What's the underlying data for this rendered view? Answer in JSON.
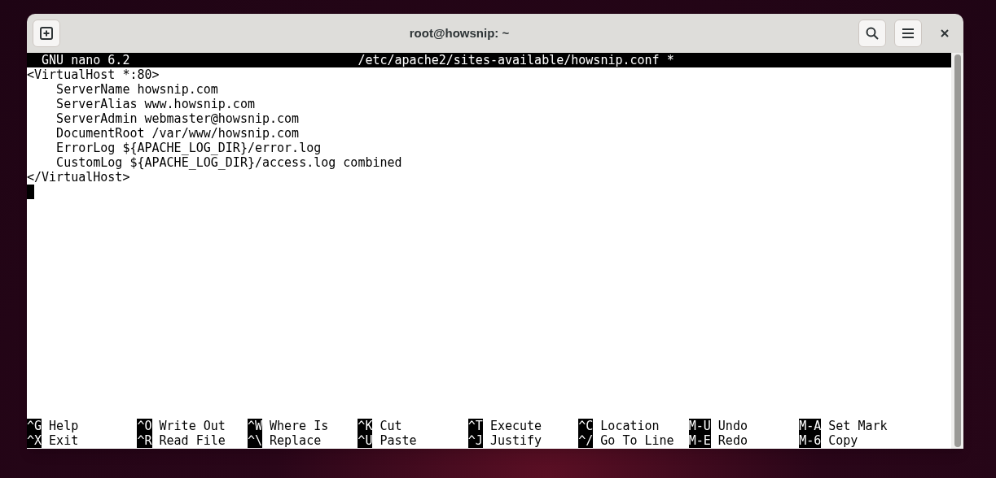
{
  "window": {
    "title": "root@howsnip: ~"
  },
  "editor": {
    "version": "GNU nano 6.2",
    "filename": "/etc/apache2/sites-available/howsnip.conf *",
    "lines": [
      "<VirtualHost *:80>",
      "    ServerName howsnip.com",
      "    ServerAlias www.howsnip.com",
      "    ServerAdmin webmaster@howsnip.com",
      "    DocumentRoot /var/www/howsnip.com",
      "    ErrorLog ${APACHE_LOG_DIR}/error.log",
      "    CustomLog ${APACHE_LOG_DIR}/access.log combined",
      "</VirtualHost>"
    ]
  },
  "shortcuts": [
    [
      {
        "key": "^G",
        "label": "Help"
      },
      {
        "key": "^O",
        "label": "Write Out"
      },
      {
        "key": "^W",
        "label": "Where Is"
      },
      {
        "key": "^K",
        "label": "Cut"
      },
      {
        "key": "^T",
        "label": "Execute"
      },
      {
        "key": "^C",
        "label": "Location"
      },
      {
        "key": "M-U",
        "label": "Undo"
      },
      {
        "key": "M-A",
        "label": "Set Mark"
      }
    ],
    [
      {
        "key": "^X",
        "label": "Exit"
      },
      {
        "key": "^R",
        "label": "Read File"
      },
      {
        "key": "^\\",
        "label": "Replace"
      },
      {
        "key": "^U",
        "label": "Paste"
      },
      {
        "key": "^J",
        "label": "Justify"
      },
      {
        "key": "^/",
        "label": "Go To Line"
      },
      {
        "key": "M-E",
        "label": "Redo"
      },
      {
        "key": "M-6",
        "label": "Copy"
      }
    ]
  ]
}
